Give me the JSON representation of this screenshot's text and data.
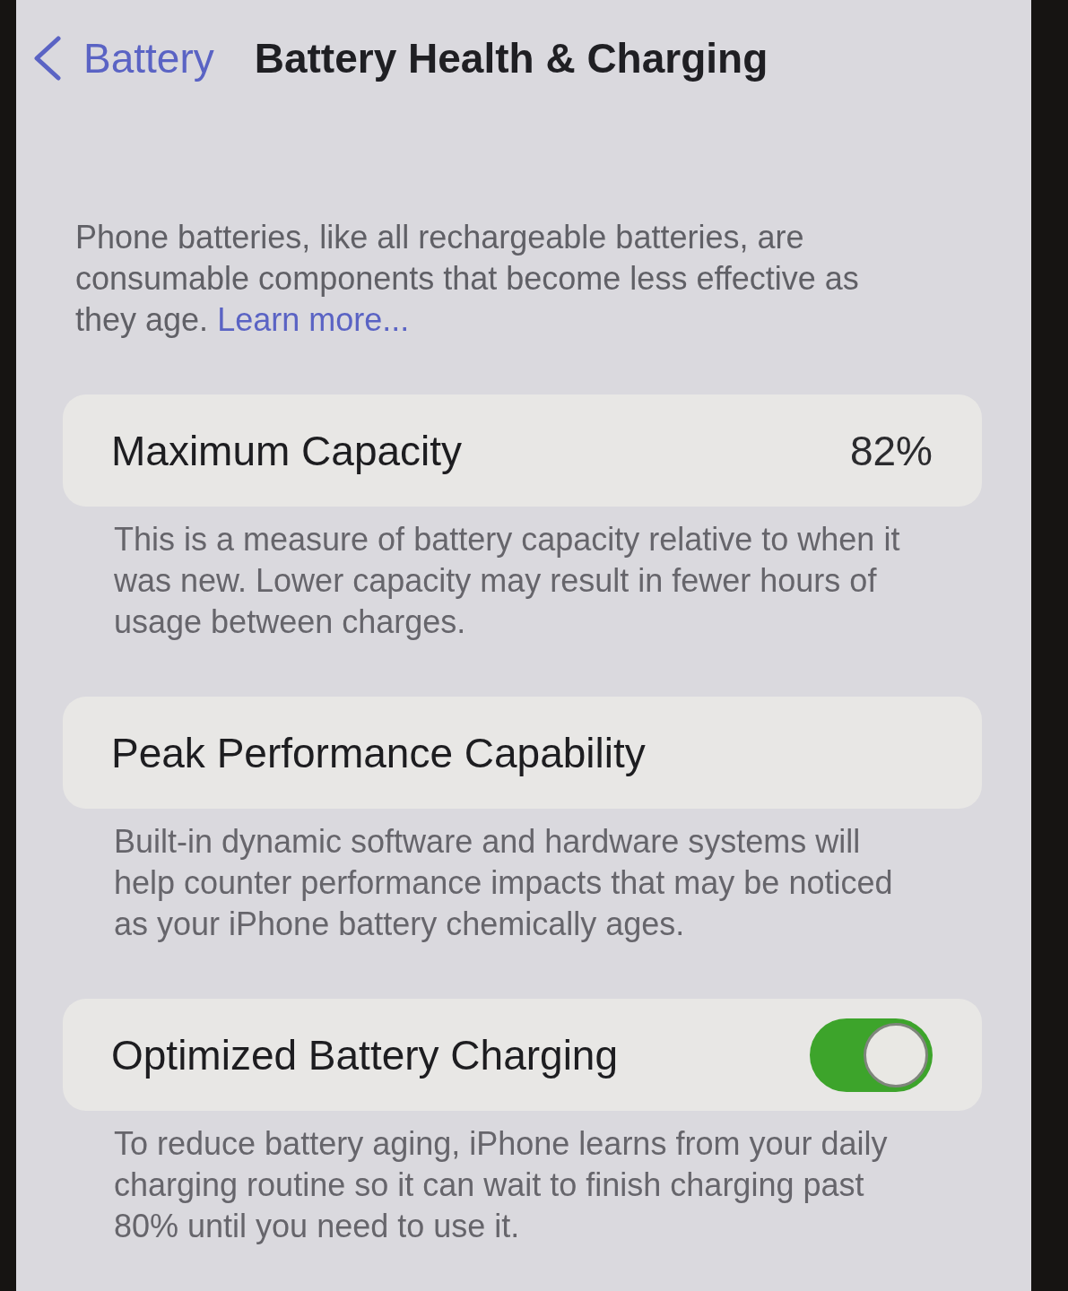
{
  "nav": {
    "back_label": "Battery",
    "title": "Battery Health & Charging"
  },
  "intro": {
    "text": "Phone batteries, like all rechargeable batteries, are\nconsumable components that become less effective as\nthey age.",
    "link": "Learn more..."
  },
  "sections": [
    {
      "kind": "value",
      "label": "Maximum Capacity",
      "value": "82%",
      "description": "This is a measure of battery capacity relative to when it\nwas new. Lower capacity may result in fewer hours of\nusage between charges."
    },
    {
      "kind": "plain",
      "label": "Peak Performance Capability",
      "description": "Built-in dynamic software and hardware systems will\nhelp counter performance impacts that may be noticed\nas your iPhone battery chemically ages."
    },
    {
      "kind": "toggle",
      "label": "Optimized Battery Charging",
      "on": true,
      "description": "To reduce battery aging, iPhone learns from your daily\ncharging routine so it can wait to finish charging past\n80% until you need to use it."
    }
  ]
}
